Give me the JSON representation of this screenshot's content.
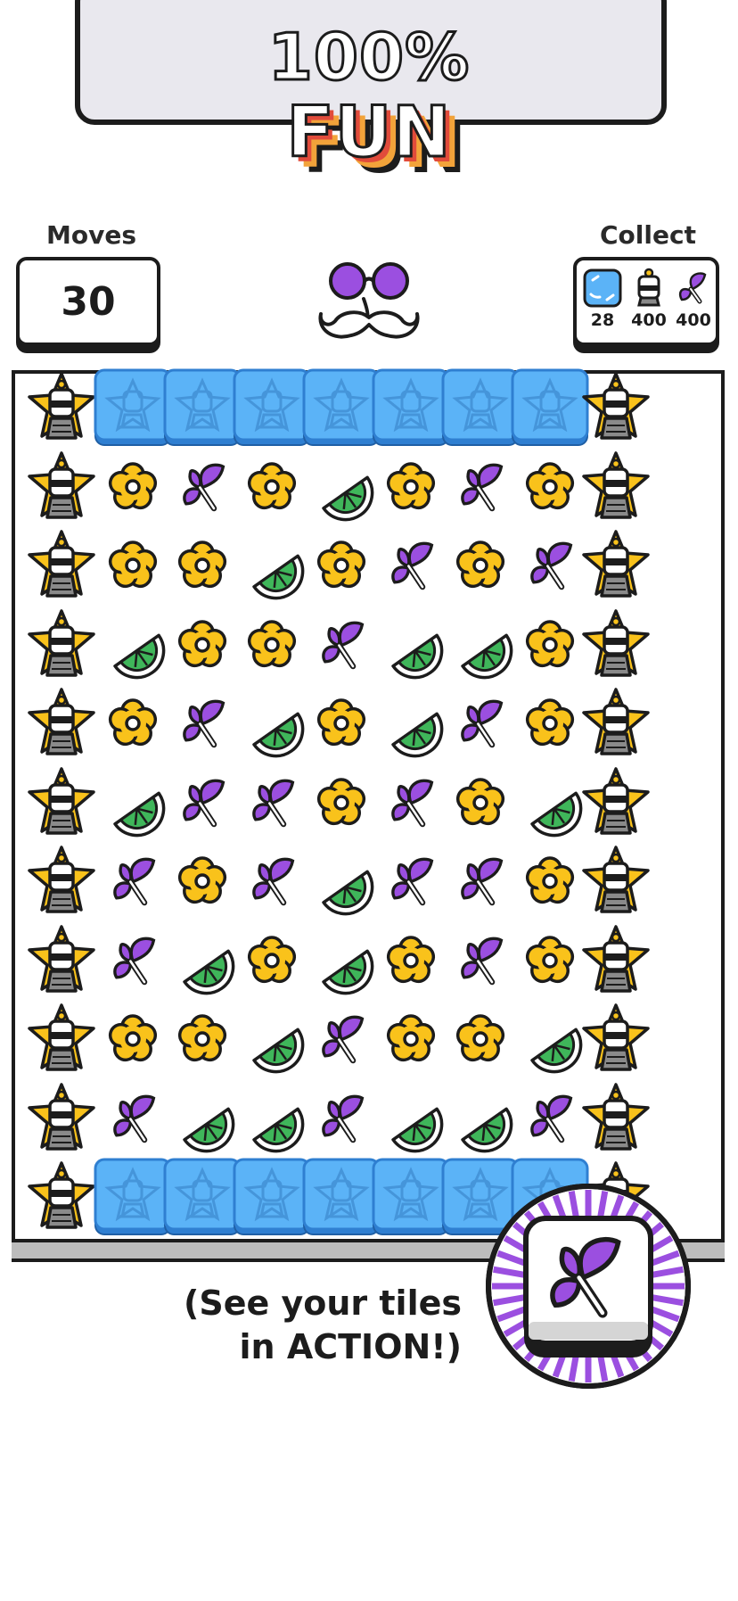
{
  "banner": {
    "line1": "100%",
    "line2": "FUN"
  },
  "moves": {
    "label": "Moves",
    "value": "30"
  },
  "collect": {
    "label": "Collect",
    "goals": [
      {
        "icon": "ice-tile-icon",
        "count": "28"
      },
      {
        "icon": "lantern-icon",
        "count": "400"
      },
      {
        "icon": "butterfly-icon",
        "count": "400"
      }
    ]
  },
  "board": {
    "rows": [
      [
        "star",
        "ice",
        "ice",
        "ice",
        "ice",
        "ice",
        "ice",
        "ice",
        "star"
      ],
      [
        "star",
        "flower",
        "butterfly",
        "flower",
        "lime",
        "flower",
        "butterfly",
        "flower",
        "star"
      ],
      [
        "star",
        "flower",
        "flower",
        "lime",
        "flower",
        "butterfly",
        "flower",
        "butterfly",
        "star"
      ],
      [
        "star",
        "lime",
        "flower",
        "flower",
        "butterfly",
        "lime",
        "lime",
        "flower",
        "star"
      ],
      [
        "star",
        "flower",
        "butterfly",
        "lime",
        "flower",
        "lime",
        "butterfly",
        "flower",
        "star"
      ],
      [
        "star",
        "lime",
        "butterfly",
        "butterfly",
        "flower",
        "butterfly",
        "flower",
        "lime",
        "star"
      ],
      [
        "star",
        "butterfly",
        "flower",
        "butterfly",
        "lime",
        "butterfly",
        "butterfly",
        "flower",
        "star"
      ],
      [
        "star",
        "butterfly",
        "lime",
        "flower",
        "lime",
        "flower",
        "butterfly",
        "flower",
        "star"
      ],
      [
        "star",
        "flower",
        "flower",
        "lime",
        "butterfly",
        "flower",
        "flower",
        "lime",
        "star"
      ],
      [
        "star",
        "butterfly",
        "lime",
        "lime",
        "butterfly",
        "lime",
        "lime",
        "butterfly",
        "star"
      ],
      [
        "star",
        "ice",
        "ice",
        "ice",
        "ice",
        "ice",
        "ice",
        "ice",
        "star"
      ]
    ]
  },
  "caption": {
    "line1": "(See your tiles",
    "line2": "in ACTION!)"
  },
  "colors": {
    "flower": "#f9c21b",
    "butterfly": "#9b4fe0",
    "lime": "#3fb65a",
    "ice": "#5bb3f7",
    "star": "#f9c21b",
    "outline": "#1c1c1c"
  }
}
